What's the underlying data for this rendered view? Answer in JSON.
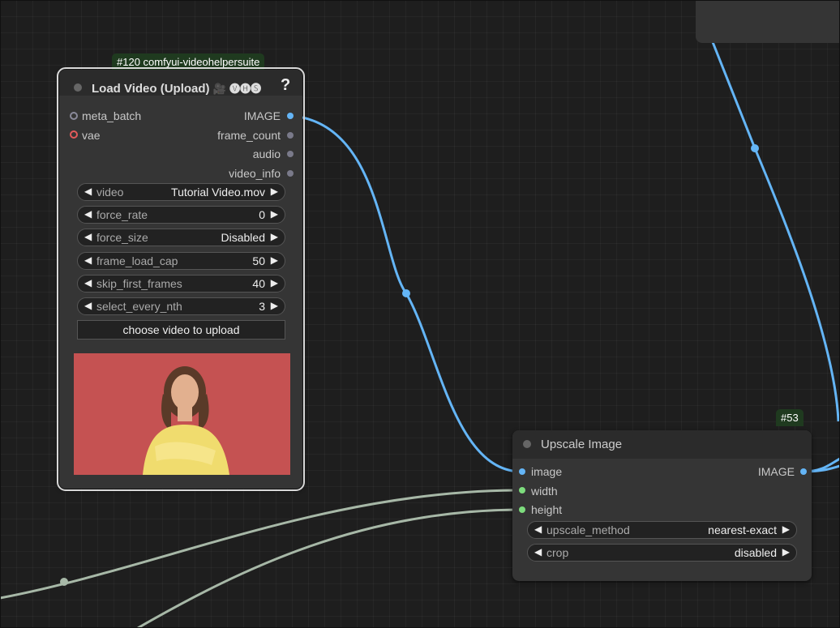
{
  "load_video_node": {
    "badge": "#120 comfyui-videohelpersuite",
    "title": "Load Video (Upload)",
    "title_emoji": "🎥",
    "title_suffix": "🅥🅗🅢",
    "help": "?",
    "inputs": [
      "meta_batch",
      "vae"
    ],
    "outputs": [
      "IMAGE",
      "frame_count",
      "audio",
      "video_info"
    ],
    "widgets": [
      {
        "name": "video",
        "value": "Tutorial Video.mov"
      },
      {
        "name": "force_rate",
        "value": "0"
      },
      {
        "name": "force_size",
        "value": "Disabled"
      },
      {
        "name": "frame_load_cap",
        "value": "50"
      },
      {
        "name": "skip_first_frames",
        "value": "40"
      },
      {
        "name": "select_every_nth",
        "value": "3"
      }
    ],
    "upload_button": "choose video to upload"
  },
  "upscale_node": {
    "badge": "#53",
    "title": "Upscale Image",
    "inputs": [
      "image",
      "width",
      "height"
    ],
    "outputs": [
      "IMAGE"
    ],
    "widgets": [
      {
        "name": "upscale_method",
        "value": "nearest-exact"
      },
      {
        "name": "crop",
        "value": "disabled"
      }
    ]
  },
  "arrow_left": "◀",
  "arrow_right": "▶",
  "colors": {
    "image_link": "#64b5f6",
    "int_link": "#a7b8a7",
    "canvas": "#1e1e1e",
    "node_bg": "#353535",
    "badge_bg": "#1f3a1f"
  }
}
